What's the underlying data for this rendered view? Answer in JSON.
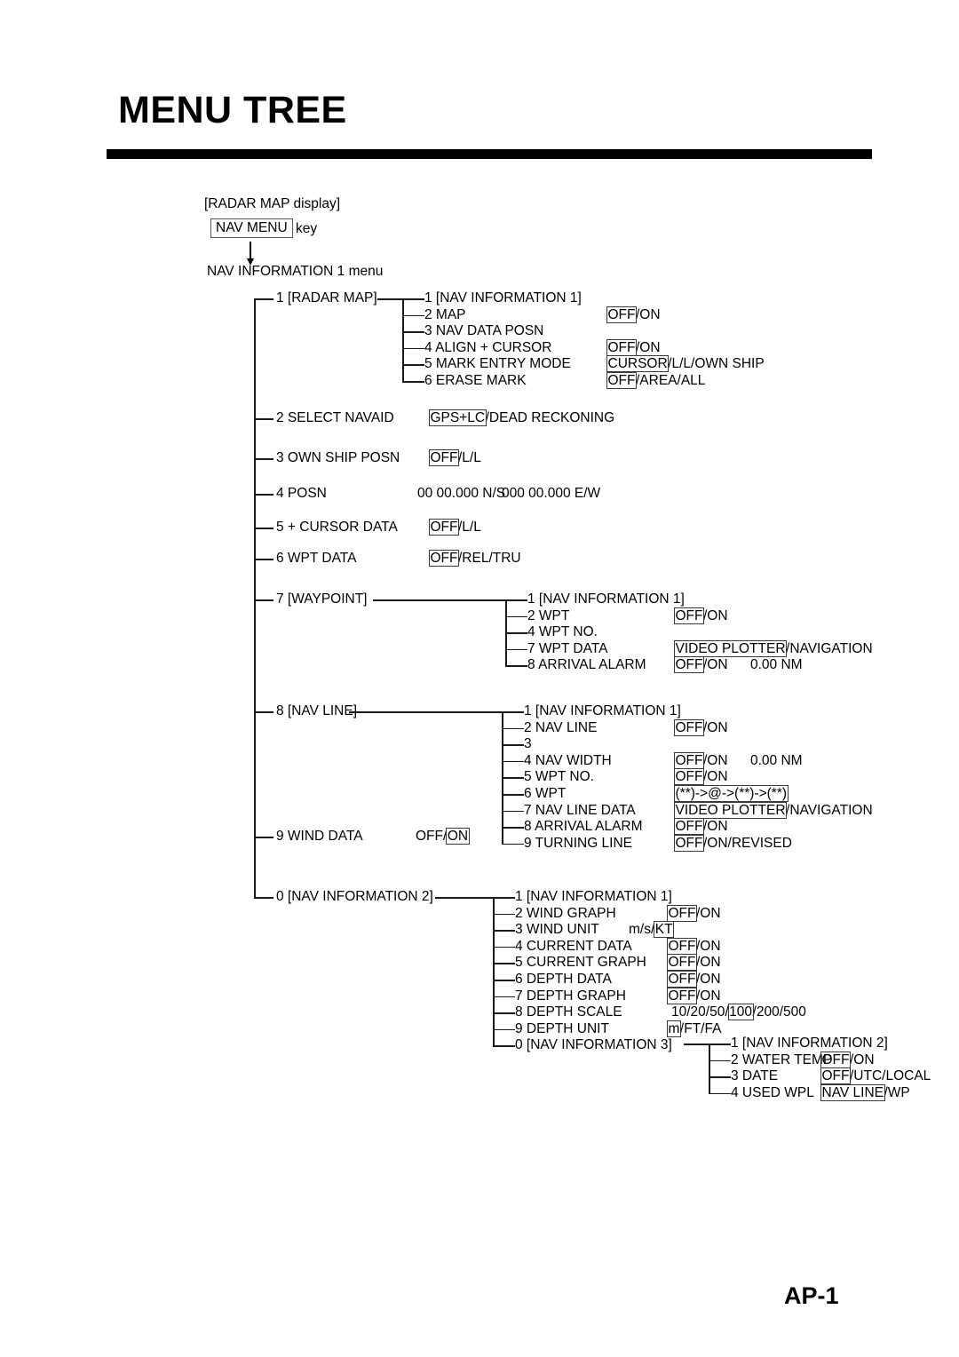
{
  "header": {
    "title": "MENU TREE",
    "page_number": "AP-1"
  },
  "intro": {
    "display": "[RADAR MAP display]",
    "key_label": "NAV MENU",
    "key_suffix": "key",
    "menu": "NAV INFORMATION 1 menu"
  },
  "tree": {
    "root_items": [
      {
        "label": "1 [RADAR MAP]"
      },
      {
        "label": "2 SELECT NAVAID",
        "value": [
          {
            "t": "GPS+LC",
            "sel": true
          },
          {
            "t": "/DEAD RECKONING",
            "sel": false
          }
        ]
      },
      {
        "label": "3 OWN SHIP POSN",
        "value": [
          {
            "t": "OFF",
            "sel": true
          },
          {
            "t": "/L/L",
            "sel": false
          }
        ]
      },
      {
        "label": "4 POSN",
        "extra": "00 00.000 N/S",
        "extra2": "000 00.000 E/W"
      },
      {
        "label": "5 + CURSOR DATA",
        "value": [
          {
            "t": "OFF",
            "sel": true
          },
          {
            "t": "/L/L",
            "sel": false
          }
        ]
      },
      {
        "label": "6 WPT DATA",
        "value": [
          {
            "t": "OFF",
            "sel": true
          },
          {
            "t": "/REL/TRU",
            "sel": false
          }
        ]
      },
      {
        "label": "7 [WAYPOINT]"
      },
      {
        "label": "8 [NAV LINE]"
      },
      {
        "label": "9 WIND DATA",
        "value": [
          {
            "t": "OFF/",
            "sel": false
          },
          {
            "t": "ON",
            "sel": true
          }
        ]
      },
      {
        "label": "0 [NAV INFORMATION 2]"
      }
    ],
    "radar_map": [
      {
        "label": "1 [NAV INFORMATION 1]"
      },
      {
        "label": "2 MAP",
        "value": [
          {
            "t": "OFF",
            "sel": true
          },
          {
            "t": "/ON",
            "sel": false
          }
        ]
      },
      {
        "label": "3 NAV DATA POSN"
      },
      {
        "label": "4 ALIGN + CURSOR",
        "value": [
          {
            "t": "OFF",
            "sel": true
          },
          {
            "t": "/ON",
            "sel": false
          }
        ]
      },
      {
        "label": "5 MARK ENTRY MODE",
        "value": [
          {
            "t": "CURSOR",
            "sel": true
          },
          {
            "t": "/L/L/OWN SHIP",
            "sel": false
          }
        ]
      },
      {
        "label": "6 ERASE MARK",
        "value": [
          {
            "t": "OFF",
            "sel": true
          },
          {
            "t": "/AREA/ALL",
            "sel": false
          }
        ]
      }
    ],
    "waypoint": [
      {
        "label": "1 [NAV INFORMATION 1]"
      },
      {
        "label": "2 WPT",
        "value": [
          {
            "t": "OFF",
            "sel": true
          },
          {
            "t": "/ON",
            "sel": false
          }
        ]
      },
      {
        "label": "4 WPT NO."
      },
      {
        "label": "7 WPT DATA",
        "value": [
          {
            "t": "VIDEO PLOTTER",
            "sel": true
          },
          {
            "t": "/NAVIGATION",
            "sel": false
          }
        ]
      },
      {
        "label": "8 ARRIVAL ALARM",
        "value": [
          {
            "t": "OFF",
            "sel": true
          },
          {
            "t": "/ON",
            "sel": false
          }
        ],
        "extra": "0.00 NM"
      }
    ],
    "nav_line": [
      {
        "label": "1 [NAV INFORMATION 1]"
      },
      {
        "label": "2 NAV LINE",
        "value": [
          {
            "t": "OFF",
            "sel": true
          },
          {
            "t": "/ON",
            "sel": false
          }
        ]
      },
      {
        "label": "3"
      },
      {
        "label": "4 NAV WIDTH",
        "value": [
          {
            "t": "OFF",
            "sel": true
          },
          {
            "t": "/ON",
            "sel": false
          }
        ],
        "extra": "0.00 NM"
      },
      {
        "label": "5 WPT NO.",
        "value": [
          {
            "t": "OFF",
            "sel": true
          },
          {
            "t": "/ON",
            "sel": false
          }
        ]
      },
      {
        "label": "6 WPT",
        "value": [
          {
            "t": "(**)->@->(**)->(**)",
            "sel": true
          }
        ]
      },
      {
        "label": "7 NAV LINE DATA",
        "value": [
          {
            "t": "VIDEO PLOTTER",
            "sel": true
          },
          {
            "t": "/NAVIGATION",
            "sel": false
          }
        ]
      },
      {
        "label": "8 ARRIVAL ALARM",
        "value": [
          {
            "t": "OFF",
            "sel": true
          },
          {
            "t": "/ON",
            "sel": false
          }
        ]
      },
      {
        "label": "9 TURNING LINE",
        "value": [
          {
            "t": "OFF",
            "sel": true
          },
          {
            "t": "/ON/REVISED",
            "sel": false
          }
        ]
      }
    ],
    "nav_info_2": [
      {
        "label": "1 [NAV INFORMATION 1]"
      },
      {
        "label": "2 WIND GRAPH",
        "value": [
          {
            "t": "OFF",
            "sel": true
          },
          {
            "t": "/ON",
            "sel": false
          }
        ]
      },
      {
        "label": "3 WIND UNIT",
        "value": [
          {
            "t": "m/s/",
            "sel": false
          },
          {
            "t": "KT",
            "sel": true
          }
        ]
      },
      {
        "label": "4 CURRENT DATA",
        "value": [
          {
            "t": "OFF",
            "sel": true
          },
          {
            "t": "/ON",
            "sel": false
          }
        ]
      },
      {
        "label": "5 CURRENT GRAPH",
        "value": [
          {
            "t": "OFF",
            "sel": true
          },
          {
            "t": "/ON",
            "sel": false
          }
        ]
      },
      {
        "label": "6 DEPTH DATA",
        "value": [
          {
            "t": "OFF",
            "sel": true
          },
          {
            "t": "/ON",
            "sel": false
          }
        ]
      },
      {
        "label": "7 DEPTH GRAPH",
        "value": [
          {
            "t": "OFF",
            "sel": true
          },
          {
            "t": "/ON",
            "sel": false
          }
        ]
      },
      {
        "label": "8 DEPTH SCALE",
        "value": [
          {
            "t": "10/20/50/",
            "sel": false
          },
          {
            "t": "100",
            "sel": true
          },
          {
            "t": "/200/500",
            "sel": false
          }
        ]
      },
      {
        "label": "9 DEPTH UNIT",
        "value": [
          {
            "t": "m",
            "sel": true
          },
          {
            "t": "/FT/FA",
            "sel": false
          }
        ]
      },
      {
        "label": "0 [NAV INFORMATION 3]"
      }
    ],
    "nav_info_3": [
      {
        "label": "1 [NAV INFORMATION 2]"
      },
      {
        "label": "2 WATER TEMP",
        "value": [
          {
            "t": "OFF",
            "sel": true
          },
          {
            "t": "/ON",
            "sel": false
          }
        ]
      },
      {
        "label": "3 DATE",
        "value": [
          {
            "t": "OFF",
            "sel": true
          },
          {
            "t": "/UTC/LOCAL",
            "sel": false
          }
        ]
      },
      {
        "label": "4 USED WPL",
        "value": [
          {
            "t": "NAV LINE",
            "sel": true
          },
          {
            "t": "/WP",
            "sel": false
          }
        ]
      }
    ]
  }
}
